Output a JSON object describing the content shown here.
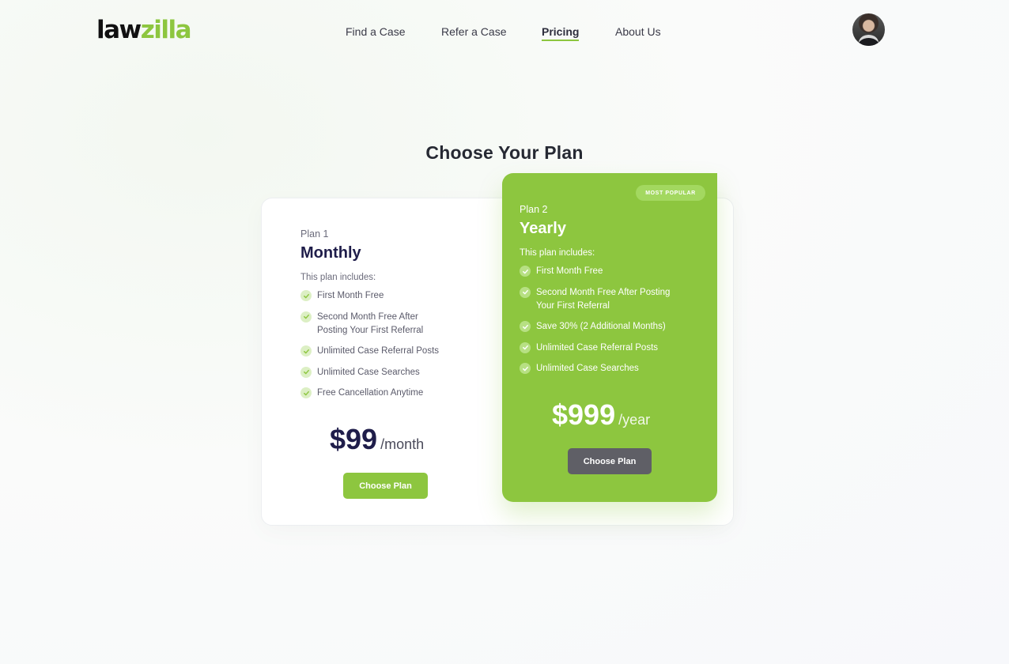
{
  "brand": {
    "part1": "law",
    "part2": "zilla"
  },
  "nav": {
    "items": [
      {
        "label": "Find a Case"
      },
      {
        "label": "Refer a Case"
      },
      {
        "label": "Pricing",
        "active": true
      },
      {
        "label": "About Us"
      }
    ]
  },
  "user": {
    "avatar_alt": "User avatar"
  },
  "page": {
    "heading": "Choose Your Plan"
  },
  "plans": [
    {
      "number": "Plan 1",
      "name": "Monthly",
      "includes": "This plan includes:",
      "features": [
        "First Month Free",
        "Second Month Free After Posting Your First Referral",
        "Unlimited Case Referral Posts",
        "Unlimited Case Searches",
        "Free Cancellation Anytime"
      ],
      "price": "$99",
      "period": "/month",
      "button": "Choose Plan"
    },
    {
      "badge": "MOST POPULAR",
      "number": "Plan 2",
      "name": "Yearly",
      "includes": "This plan includes:",
      "features": [
        "First Month Free",
        "Second Month Free After Posting Your First Referral",
        "Save 30% (2 Additional Months)",
        "Unlimited Case Referral Posts",
        "Unlimited Case Searches"
      ],
      "price": "$999",
      "period": "/year",
      "button": "Choose Plan"
    }
  ],
  "colors": {
    "brand_green": "#8dc63f",
    "dark_text": "#1f1d4a",
    "gray_button": "#5f5f66"
  }
}
